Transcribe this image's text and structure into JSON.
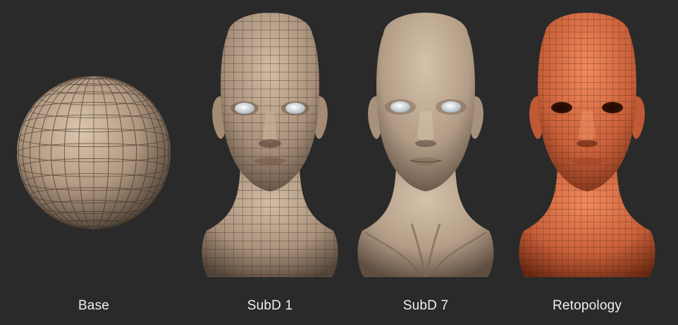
{
  "labels": {
    "base": "Base",
    "subd1": "SubD 1",
    "subd7": "SubD 7",
    "retopology": "Retopology"
  },
  "colors": {
    "background": "#2a2a2a",
    "sculpt_skin": "#c2ab93",
    "sculpt_shadow": "#5c4c3e",
    "wire": "#3a2f27",
    "retopo_skin": "#d96f45",
    "retopo_shadow": "#6e2a14",
    "label_text": "#f0f0f0"
  }
}
